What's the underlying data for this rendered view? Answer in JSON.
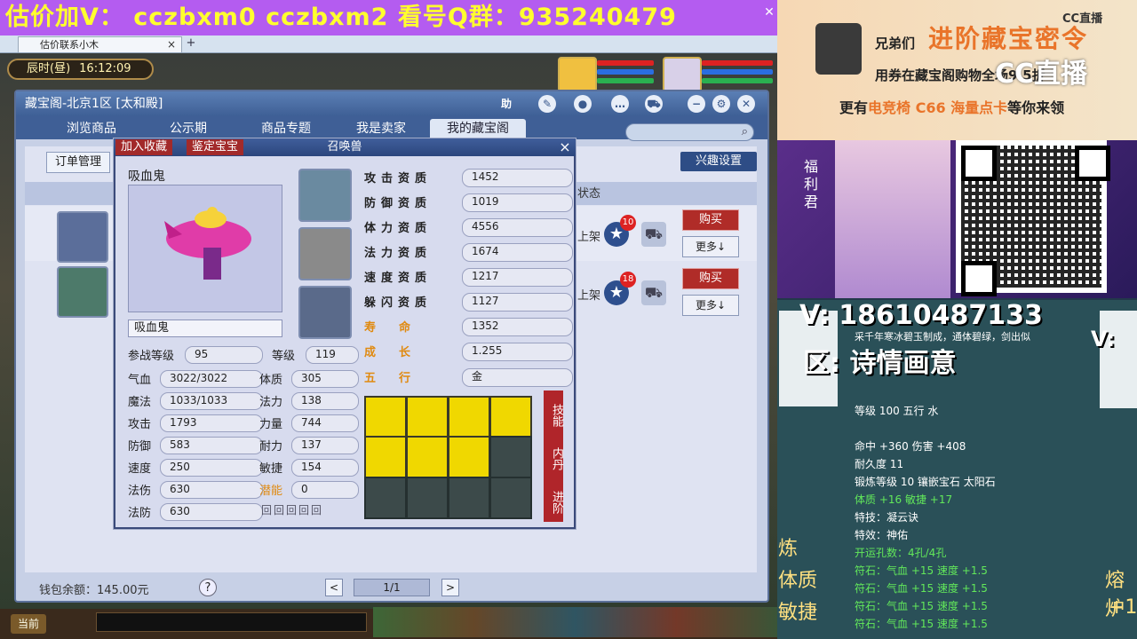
{
  "banner": {
    "text": "估价加V：  cczbxm0   cczbxm2   看号Q群：935240479"
  },
  "browser": {
    "tab_label": "估价联系小木",
    "close": "×",
    "new_tab": "+"
  },
  "hud": {
    "time_label": "辰时(昼)",
    "time": "16:12:09"
  },
  "dialog": {
    "title": "藏宝阁-北京1区 [太和殿]",
    "help": "助",
    "nav": [
      "浏览商品",
      "公示期",
      "商品专题",
      "我是卖家",
      "我的藏宝阁"
    ],
    "order_mgmt": "订单管理",
    "interest": "兴趣设置",
    "status_header": "状态",
    "rows": [
      {
        "fav_count": "10",
        "buy": "购买",
        "more": "更多↓",
        "shelf": "上架"
      },
      {
        "fav_count": "18",
        "buy": "购买",
        "more": "更多↓",
        "shelf": "上架"
      }
    ],
    "wallet": "钱包余额：145.00元",
    "help_q": "?",
    "page": "1/1",
    "prev": "<",
    "next": ">"
  },
  "pet": {
    "add_fav": "加入收藏",
    "appraise": "鉴定宝宝",
    "title": "召唤兽",
    "close": "×",
    "name_top": "吸血鬼",
    "name_field": "吸血鬼",
    "stats_left": [
      {
        "label": "参战等级",
        "value": "95"
      },
      {
        "label": "气血",
        "value": "3022/3022"
      },
      {
        "label": "魔法",
        "value": "1033/1033"
      },
      {
        "label": "攻击",
        "value": "1793"
      },
      {
        "label": "防御",
        "value": "583"
      },
      {
        "label": "速度",
        "value": "250"
      },
      {
        "label": "法伤",
        "value": "630"
      },
      {
        "label": "法防",
        "value": "630"
      }
    ],
    "stats_mid": [
      {
        "label": "等级",
        "value": "119"
      },
      {
        "label": "体质",
        "value": "305"
      },
      {
        "label": "法力",
        "value": "138"
      },
      {
        "label": "力量",
        "value": "744"
      },
      {
        "label": "耐力",
        "value": "137"
      },
      {
        "label": "敏捷",
        "value": "154"
      },
      {
        "label": "潜能",
        "value": "0"
      }
    ],
    "quals": [
      {
        "label": "攻击资质",
        "value": "1452"
      },
      {
        "label": "防御资质",
        "value": "1019"
      },
      {
        "label": "体力资质",
        "value": "4556"
      },
      {
        "label": "法力资质",
        "value": "1674"
      },
      {
        "label": "速度资质",
        "value": "1217"
      },
      {
        "label": "躲闪资质",
        "value": "1127"
      },
      {
        "label": "寿　　命",
        "value": "1352"
      },
      {
        "label": "成　　长",
        "value": "1.255"
      },
      {
        "label": "五　　行",
        "value": "金"
      }
    ],
    "side_buttons": [
      "技能",
      "内丹",
      "进阶"
    ]
  },
  "taskbar": {
    "current": "当前"
  },
  "overlay": {
    "ad_line1": "兄弟们",
    "ad_line2": "进阶藏宝密令",
    "ad_line3": "用券在藏宝阁购物全场9.5折",
    "ad_line4_pre": "更有",
    "ad_line4_hl": "电竞椅 C66 海量点卡",
    "ad_line4_post": "等你来领",
    "cc_logo": "CC直播",
    "cc_live": "CC直播",
    "fuli": "福利君",
    "v_line": "V: 18610487133",
    "q_line": "区: 诗情画意",
    "v_right": "V:",
    "item_desc": "采千年寒冰碧玉制成，通体碧绿，剑出似",
    "item_stats": [
      "等级 100 五行 水",
      "命中 +360 伤害 +408",
      "耐久度 11",
      "锻炼等级 10 镶嵌宝石 太阳石",
      "体质 +16 敏捷 +17",
      "特技：凝云诀",
      "特效：神佑",
      "开运孔数：4孔/4孔",
      "符石：气血 +15 速度 +1.5",
      "符石：气血 +15 速度 +1.5",
      "符石：气血 +15 速度 +1.5",
      "符石：气血 +15 速度 +1.5"
    ],
    "side_lian": "炼",
    "side_tz": "体质",
    "side_mj": "敏捷",
    "side_rr": "熔炉",
    "side_p1": "+1"
  }
}
